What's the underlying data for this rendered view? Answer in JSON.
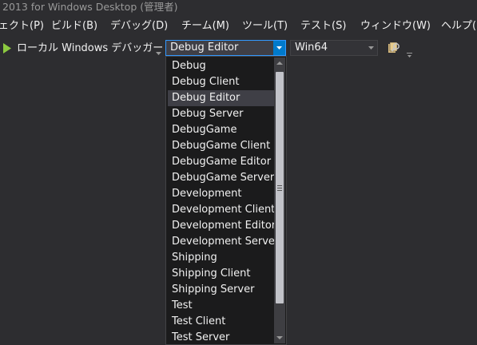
{
  "window": {
    "title": "2013 for Windows Desktop (管理者)"
  },
  "menu": [
    {
      "label": "ェクト(P)"
    },
    {
      "label": "ビルド(B)"
    },
    {
      "label": "デバッグ(D)"
    },
    {
      "label": "チーム(M)"
    },
    {
      "label": "ツール(T)"
    },
    {
      "label": "テスト(S)"
    },
    {
      "label": "ウィンドウ(W)"
    },
    {
      "label": "ヘルプ(H)"
    }
  ],
  "toolbar": {
    "start_icon": "play-icon",
    "debugger_label": "ローカル Windows デバッガー",
    "configuration_value": "Debug Editor",
    "platform_value": "Win64",
    "extra_tool_icon": "find-in-files-icon"
  },
  "configuration_dropdown": {
    "selected": "Debug Editor",
    "items": [
      "Debug",
      "Debug Client",
      "Debug Editor",
      "Debug Server",
      "DebugGame",
      "DebugGame Client",
      "DebugGame Editor",
      "DebugGame Server",
      "Development",
      "Development Client",
      "Development Editor",
      "Development Server",
      "Shipping",
      "Shipping Client",
      "Shipping Server",
      "Test",
      "Test Client",
      "Test Server"
    ]
  },
  "colors": {
    "background": "#2d2d30",
    "accent": "#007acc",
    "play_green": "#8cc940",
    "dropdown_bg": "#1b1b1c",
    "selection": "#3f3f46"
  }
}
